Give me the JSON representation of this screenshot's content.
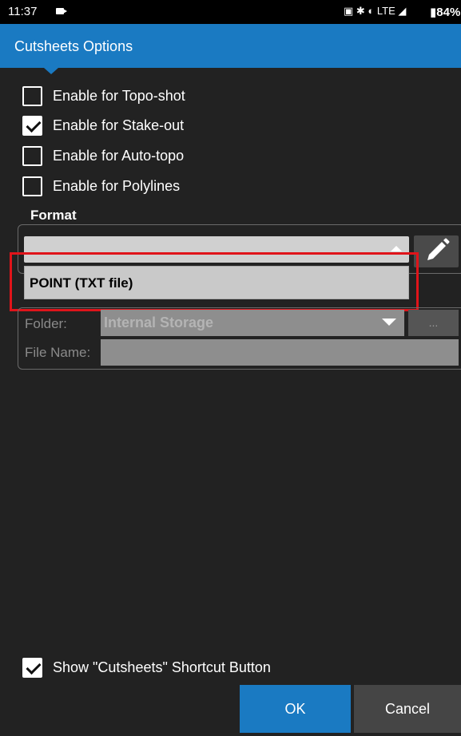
{
  "status_bar": {
    "time": "11:37",
    "icons_text": "▣ ✱ ◐ LTE ◢",
    "battery": "▮84%"
  },
  "title_bar": {
    "title": "Cutsheets Options"
  },
  "options": [
    {
      "label": "Enable for Topo-shot",
      "checked": false
    },
    {
      "label": "Enable for Stake-out",
      "checked": true
    },
    {
      "label": "Enable for Auto-topo",
      "checked": false
    },
    {
      "label": "Enable for Polylines",
      "checked": false
    }
  ],
  "format": {
    "legend": "Format",
    "selected_value": "",
    "dropdown_options": [
      "POINT (TXT file)"
    ]
  },
  "file": {
    "folder_label": "Folder:",
    "folder_value": "Internal Storage",
    "browse_label": "...",
    "filename_label": "File Name:",
    "filename_value": ""
  },
  "shortcut": {
    "label": "Show \"Cutsheets\" Shortcut Button",
    "checked": true
  },
  "footer": {
    "ok_label": "OK",
    "cancel_label": "Cancel"
  },
  "colors": {
    "accent": "#1a7ac2",
    "background": "#222222",
    "highlight": "#e0141a"
  }
}
